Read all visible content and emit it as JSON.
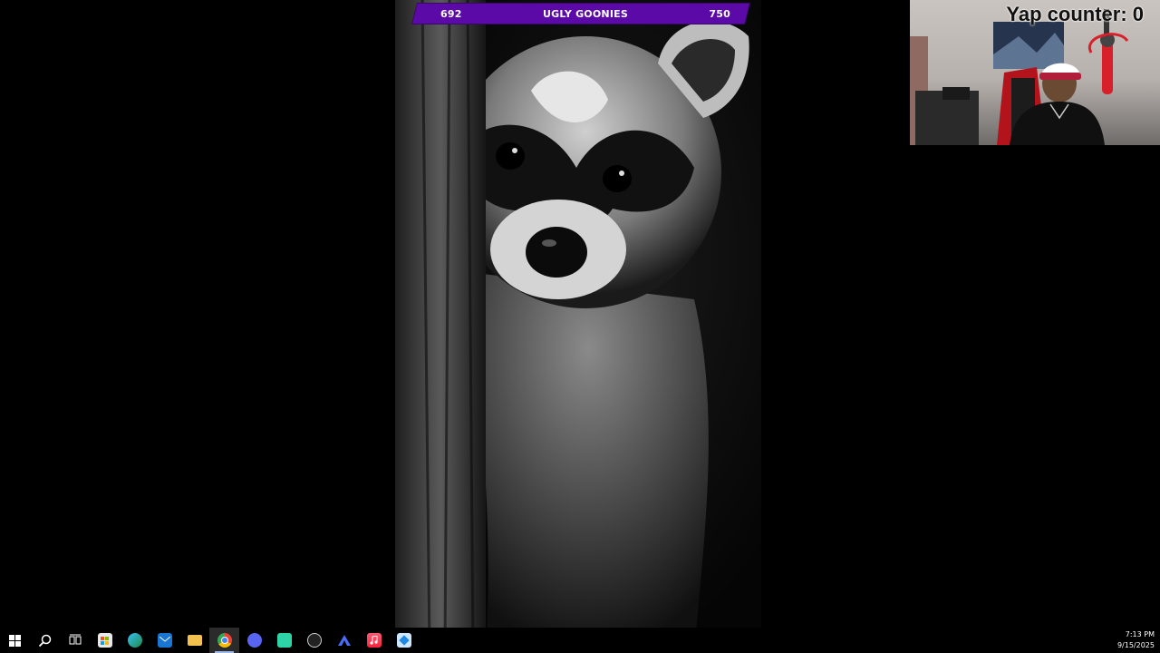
{
  "overlay": {
    "goal_left": "692",
    "goal_title": "UGLY GOONIES",
    "goal_right": "750",
    "goal_color": "#5b0aa8"
  },
  "webcam": {
    "yap_counter": "Yap counter: 0"
  },
  "taskbar": {
    "icons": [
      {
        "name": "start-icon"
      },
      {
        "name": "search-icon"
      },
      {
        "name": "task-view-icon"
      },
      {
        "name": "store-icon"
      },
      {
        "name": "edge-icon"
      },
      {
        "name": "mail-icon"
      },
      {
        "name": "file-explorer-icon"
      },
      {
        "name": "chrome-icon",
        "active": true
      },
      {
        "name": "discord-icon"
      },
      {
        "name": "app-green-icon"
      },
      {
        "name": "obs-icon"
      },
      {
        "name": "vpn-icon"
      },
      {
        "name": "music-icon"
      },
      {
        "name": "app-blue-icon"
      }
    ],
    "time": "7:13 PM",
    "date": "9/15/2025"
  }
}
